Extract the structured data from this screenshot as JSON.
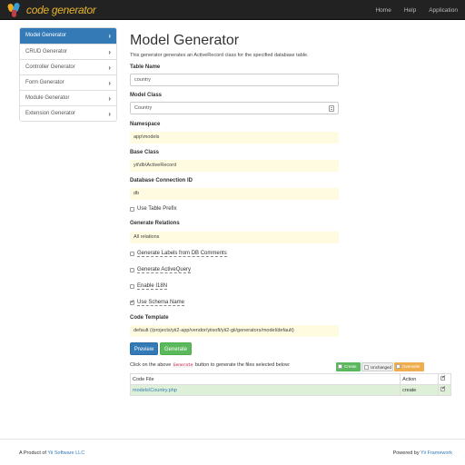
{
  "navbar": {
    "logo_text": "code generator",
    "links": [
      "Home",
      "Help",
      "Application"
    ]
  },
  "sidebar": {
    "items": [
      {
        "label": "Model Generator",
        "active": true
      },
      {
        "label": "CRUD Generator",
        "active": false
      },
      {
        "label": "Controller Generator",
        "active": false
      },
      {
        "label": "Form Generator",
        "active": false
      },
      {
        "label": "Module Generator",
        "active": false
      },
      {
        "label": "Extension Generator",
        "active": false
      }
    ]
  },
  "main": {
    "title": "Model Generator",
    "subtitle": "This generator generates an ActiveRecord class for the specified database table.",
    "fields": {
      "table_name": {
        "label": "Table Name",
        "value": "country"
      },
      "model_class": {
        "label": "Model Class",
        "value": "Country"
      },
      "namespace": {
        "label": "Namespace",
        "value": "app\\models"
      },
      "base_class": {
        "label": "Base Class",
        "value": "yii\\db\\ActiveRecord"
      },
      "db_connection": {
        "label": "Database Connection ID",
        "value": "db"
      },
      "use_table_prefix": {
        "label": "Use Table Prefix",
        "checked": false
      },
      "generate_relations": {
        "label": "Generate Relations",
        "value": "All relations"
      },
      "labels_from_db": {
        "label": "Generate Labels from DB Comments",
        "checked": false
      },
      "active_query": {
        "label": "Generate ActiveQuery",
        "checked": false
      },
      "enable_i18n": {
        "label": "Enable I18N",
        "checked": false
      },
      "use_schema_name": {
        "label": "Use Schema Name",
        "checked": true
      },
      "code_template": {
        "label": "Code Template",
        "value": "default (/projects/yii2-app/vendor/yiisoft/yii2-gii/generators/model/default)"
      }
    },
    "buttons": {
      "preview": "Preview",
      "generate": "Generate"
    },
    "hint": {
      "before": "Click on the above",
      "code": "Generate",
      "after": "button to generate the files selected below:"
    },
    "legend": {
      "create": "Create",
      "unchanged": "Unchanged",
      "overwrite": "Overwrite"
    },
    "table": {
      "headers": {
        "file": "Code File",
        "action": "Action"
      },
      "rows": [
        {
          "file": "models\\Country.php",
          "action": "create",
          "checked": true
        }
      ]
    }
  },
  "footer": {
    "left_prefix": "A Product of",
    "left_link": "Yii Software LLC",
    "right_prefix": "Powered by",
    "right_link": "Yii Framework"
  },
  "colors": {
    "navbar_bg": "#222222",
    "active_blue": "#337ab7",
    "success_green": "#5cb85c",
    "warning_orange": "#f0ad4e",
    "sticky_yellow": "#fffbe0"
  }
}
